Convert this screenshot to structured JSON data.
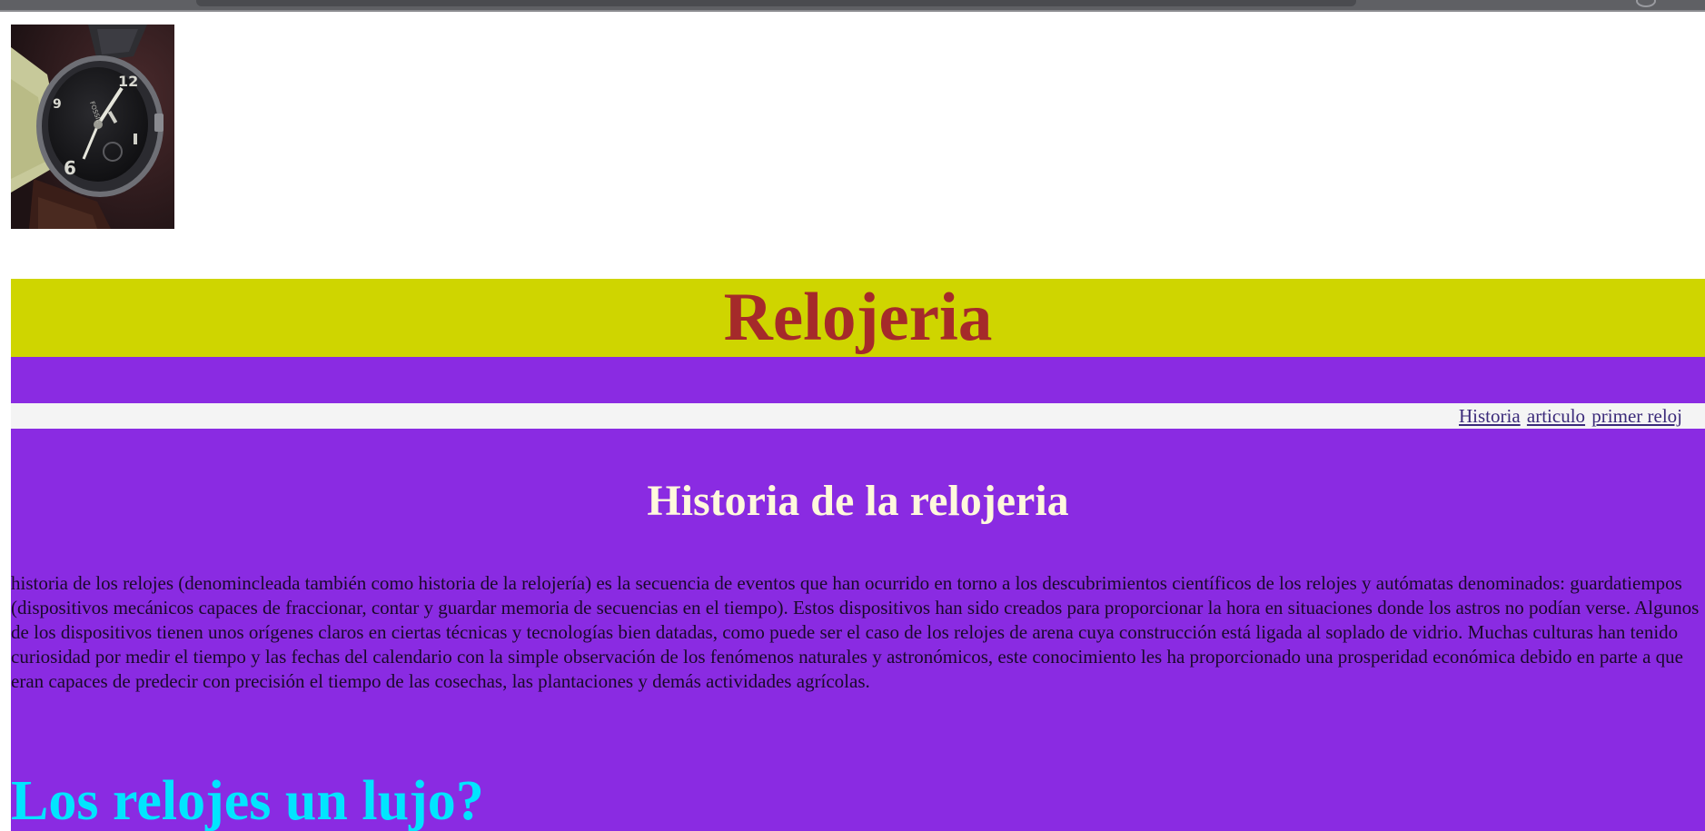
{
  "header": {
    "title": "Relojeria"
  },
  "nav": {
    "links": [
      "Historia",
      "articulo",
      "primer reloj"
    ]
  },
  "main": {
    "section_title": "Historia de la relojeria",
    "history_paragraph": "historia de los relojes (denomincleada también como historia de la relojería) es la secuencia de eventos que han ocurrido en torno a los descubrimientos científicos de los relojes y autómatas denominados: guardatiempos (dispositivos mecánicos capaces de fraccionar, contar y guardar memoria de secuencias en el tiempo). Estos dispositivos han sido creados para proporcionar la hora en situaciones donde los astros no podían verse. Algunos de los dispositivos tienen unos orígenes claros en ciertas técnicas y tecnologías bien datadas, como puede ser el caso de los relojes de arena cuya construcción está ligada al soplado de vidrio. Muchas culturas han tenido curiosidad por medir el tiempo y las fechas del calendario con la simple observación de los fenómenos naturales y astronómicos, este conocimiento les ha proporcionado una prosperidad económica debido en parte a que eran capaces de predecir con precisión el tiempo de las cosechas, las plantaciones y demás actividades agrícolas.",
    "luxury_title": "Los relojes un lujo?"
  },
  "colors": {
    "header_bg": "#cfd500",
    "title_color": "#a52a2a",
    "purple_bg": "#8a2be2",
    "nav_bg": "#f4f4f4",
    "section_title_color": "#fff8dc",
    "luxury_title_color": "#00e5ff"
  },
  "icons": {
    "photo": "wristwatch-photo"
  }
}
